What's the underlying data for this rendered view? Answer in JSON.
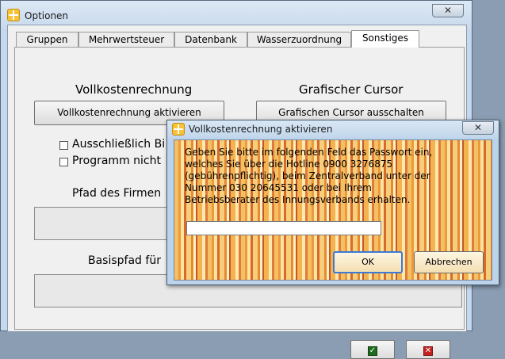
{
  "main_window": {
    "title": "Optionen",
    "close_glyph": "✕"
  },
  "tabs": [
    {
      "label": "Gruppen"
    },
    {
      "label": "Mehrwertsteuer"
    },
    {
      "label": "Datenbank"
    },
    {
      "label": "Wasserzuordnung"
    },
    {
      "label": "Sonstiges",
      "active": true
    }
  ],
  "panel": {
    "full_cost_heading": "Vollkostenrechnung",
    "full_cost_button": "Vollkostenrechnung aktivieren",
    "cursor_heading": "Grafischer Cursor",
    "cursor_button": "Grafischen Cursor ausschalten",
    "checkbox1_label": "Ausschließlich Bi",
    "checkbox2_label": "Programm nicht",
    "company_path_label": "Pfad des Firmen",
    "base_path_label": "Basispfad für"
  },
  "footer": {
    "ok_icon": "✓",
    "cancel_icon": "✕"
  },
  "dialog": {
    "title": "Vollkostenrechnung aktivieren",
    "close_glyph": "✕",
    "message": "Geben Sie bitte im folgenden Feld das Passwort ein,\nwelches Sie über die Hotline 0900 3276875\n(gebührenpflichtig), beim Zentralverband unter der\nNummer 030 20645531 oder bei Ihrem\nBetriebsberater des Innungsverbands erhalten.",
    "password_value": "",
    "ok_label": "OK",
    "cancel_label": "Abbrechen"
  },
  "colors": {
    "title_bar": "#c8daed",
    "dialog_border": "#3a7bd5",
    "accent_orange": "#f3c064"
  }
}
